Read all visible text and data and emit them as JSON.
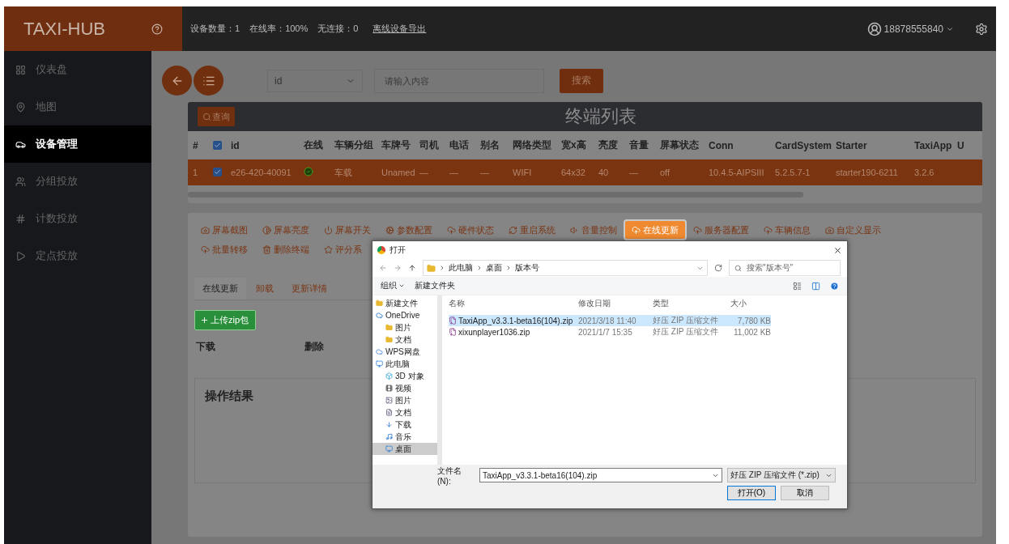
{
  "app": {
    "logo": "TAXI-HUB"
  },
  "top_bar": {
    "stats": [
      "设备数量：1",
      "在线率：100%",
      "无连接：0"
    ],
    "export_link": "离线设备导出",
    "user": "18878555840"
  },
  "sidebar": {
    "items": [
      {
        "label": "仪表盘",
        "selected": false
      },
      {
        "label": "地图",
        "selected": false
      },
      {
        "label": "设备管理",
        "selected": true
      },
      {
        "label": "分组投放",
        "selected": false
      },
      {
        "label": "计数投放",
        "selected": false
      },
      {
        "label": "定点投放",
        "selected": false
      }
    ]
  },
  "search_bar": {
    "field": "id",
    "placeholder": "请输入内容",
    "button": "搜索"
  },
  "terminal_table": {
    "query_button": "查询",
    "title": "终端列表",
    "header_checked": true,
    "columns": [
      "#",
      "id",
      "在线",
      "车辆分组",
      "车牌号",
      "司机",
      "电话",
      "别名",
      "网络类型",
      "宽x高",
      "亮度",
      "音量",
      "屏幕状态",
      "Conn",
      "CardSystem",
      "Starter",
      "TaxiApp",
      "U"
    ],
    "rows": [
      {
        "checked": true,
        "selected": true,
        "online": true,
        "cells": [
          "1",
          "e26-420-40091",
          "",
          "车载",
          "Unamed",
          "—",
          "—",
          "—",
          "WIFI",
          "64x32",
          "40",
          "—",
          "off",
          "10.4.5-AIPSIII",
          "5.2.5.7-1",
          "starter190-6211",
          "3.2.6"
        ]
      }
    ]
  },
  "actions": [
    {
      "label": "屏幕截图",
      "selected": false
    },
    {
      "label": "屏幕亮度",
      "selected": false
    },
    {
      "label": "屏幕开关",
      "selected": false
    },
    {
      "label": "参数配置",
      "selected": false
    },
    {
      "label": "硬件状态",
      "selected": false
    },
    {
      "label": "重启系统",
      "selected": false
    },
    {
      "label": "音量控制",
      "selected": false
    },
    {
      "label": "在线更新",
      "selected": true
    },
    {
      "label": "服务器配置",
      "selected": false
    },
    {
      "label": "车辆信息",
      "selected": false
    },
    {
      "label": "自定义显示",
      "selected": false
    },
    {
      "label": "批量转移",
      "selected": false
    },
    {
      "label": "删除终端",
      "selected": false
    },
    {
      "label": "评分系",
      "selected": false
    }
  ],
  "update_panel": {
    "tabs": [
      {
        "label": "在线更新",
        "selected": true
      },
      {
        "label": "卸载",
        "selected": false
      },
      {
        "label": "更新详情",
        "selected": false
      }
    ],
    "upload_button": "上传zip包",
    "columns": [
      "下载",
      "删除"
    ],
    "result_title": "操作结果"
  },
  "open_dialog": {
    "title": "打开",
    "path": [
      "此电脑",
      "桌面",
      "版本号"
    ],
    "search_placeholder": "搜索\"版本号\"",
    "organize": "组织",
    "new_folder": "新建文件夹",
    "nav": [
      {
        "label": "新建文件",
        "kind": "folder",
        "selected": false
      },
      {
        "label": "OneDrive",
        "kind": "cloud",
        "selected": false,
        "children": [
          {
            "label": "图片",
            "kind": "folder",
            "selected": false
          },
          {
            "label": "文档",
            "kind": "folder",
            "selected": false
          }
        ]
      },
      {
        "label": "WPS网盘",
        "kind": "wps",
        "selected": false
      },
      {
        "label": "此电脑",
        "kind": "computer",
        "selected": false,
        "children": [
          {
            "label": "3D 对象",
            "kind": "cube",
            "selected": false
          },
          {
            "label": "视频",
            "kind": "video",
            "selected": false
          },
          {
            "label": "图片",
            "kind": "picture",
            "selected": false
          },
          {
            "label": "文档",
            "kind": "document",
            "selected": false
          },
          {
            "label": "下载",
            "kind": "download",
            "selected": false
          },
          {
            "label": "音乐",
            "kind": "music",
            "selected": false
          },
          {
            "label": "桌面",
            "kind": "desktop",
            "selected": true
          }
        ]
      }
    ],
    "columns": [
      "名称",
      "修改日期",
      "类型",
      "大小"
    ],
    "files": [
      {
        "name": "TaxiApp_v3.3.1-beta16(104).zip",
        "date": "2021/3/18 11:40",
        "type": "好压 ZIP 压缩文件",
        "size": "7,780 KB",
        "selected": true
      },
      {
        "name": "xixunplayer1036.zip",
        "date": "2021/1/7 15:35",
        "type": "好压 ZIP 压缩文件",
        "size": "11,002 KB",
        "selected": false
      }
    ],
    "filename_label": "文件名(N):",
    "filename": "TaxiApp_v3.3.1-beta16(104).zip",
    "filter": "好压 ZIP 压缩文件 (*.zip)",
    "open_button": "打开(O)",
    "cancel_button": "取消"
  }
}
